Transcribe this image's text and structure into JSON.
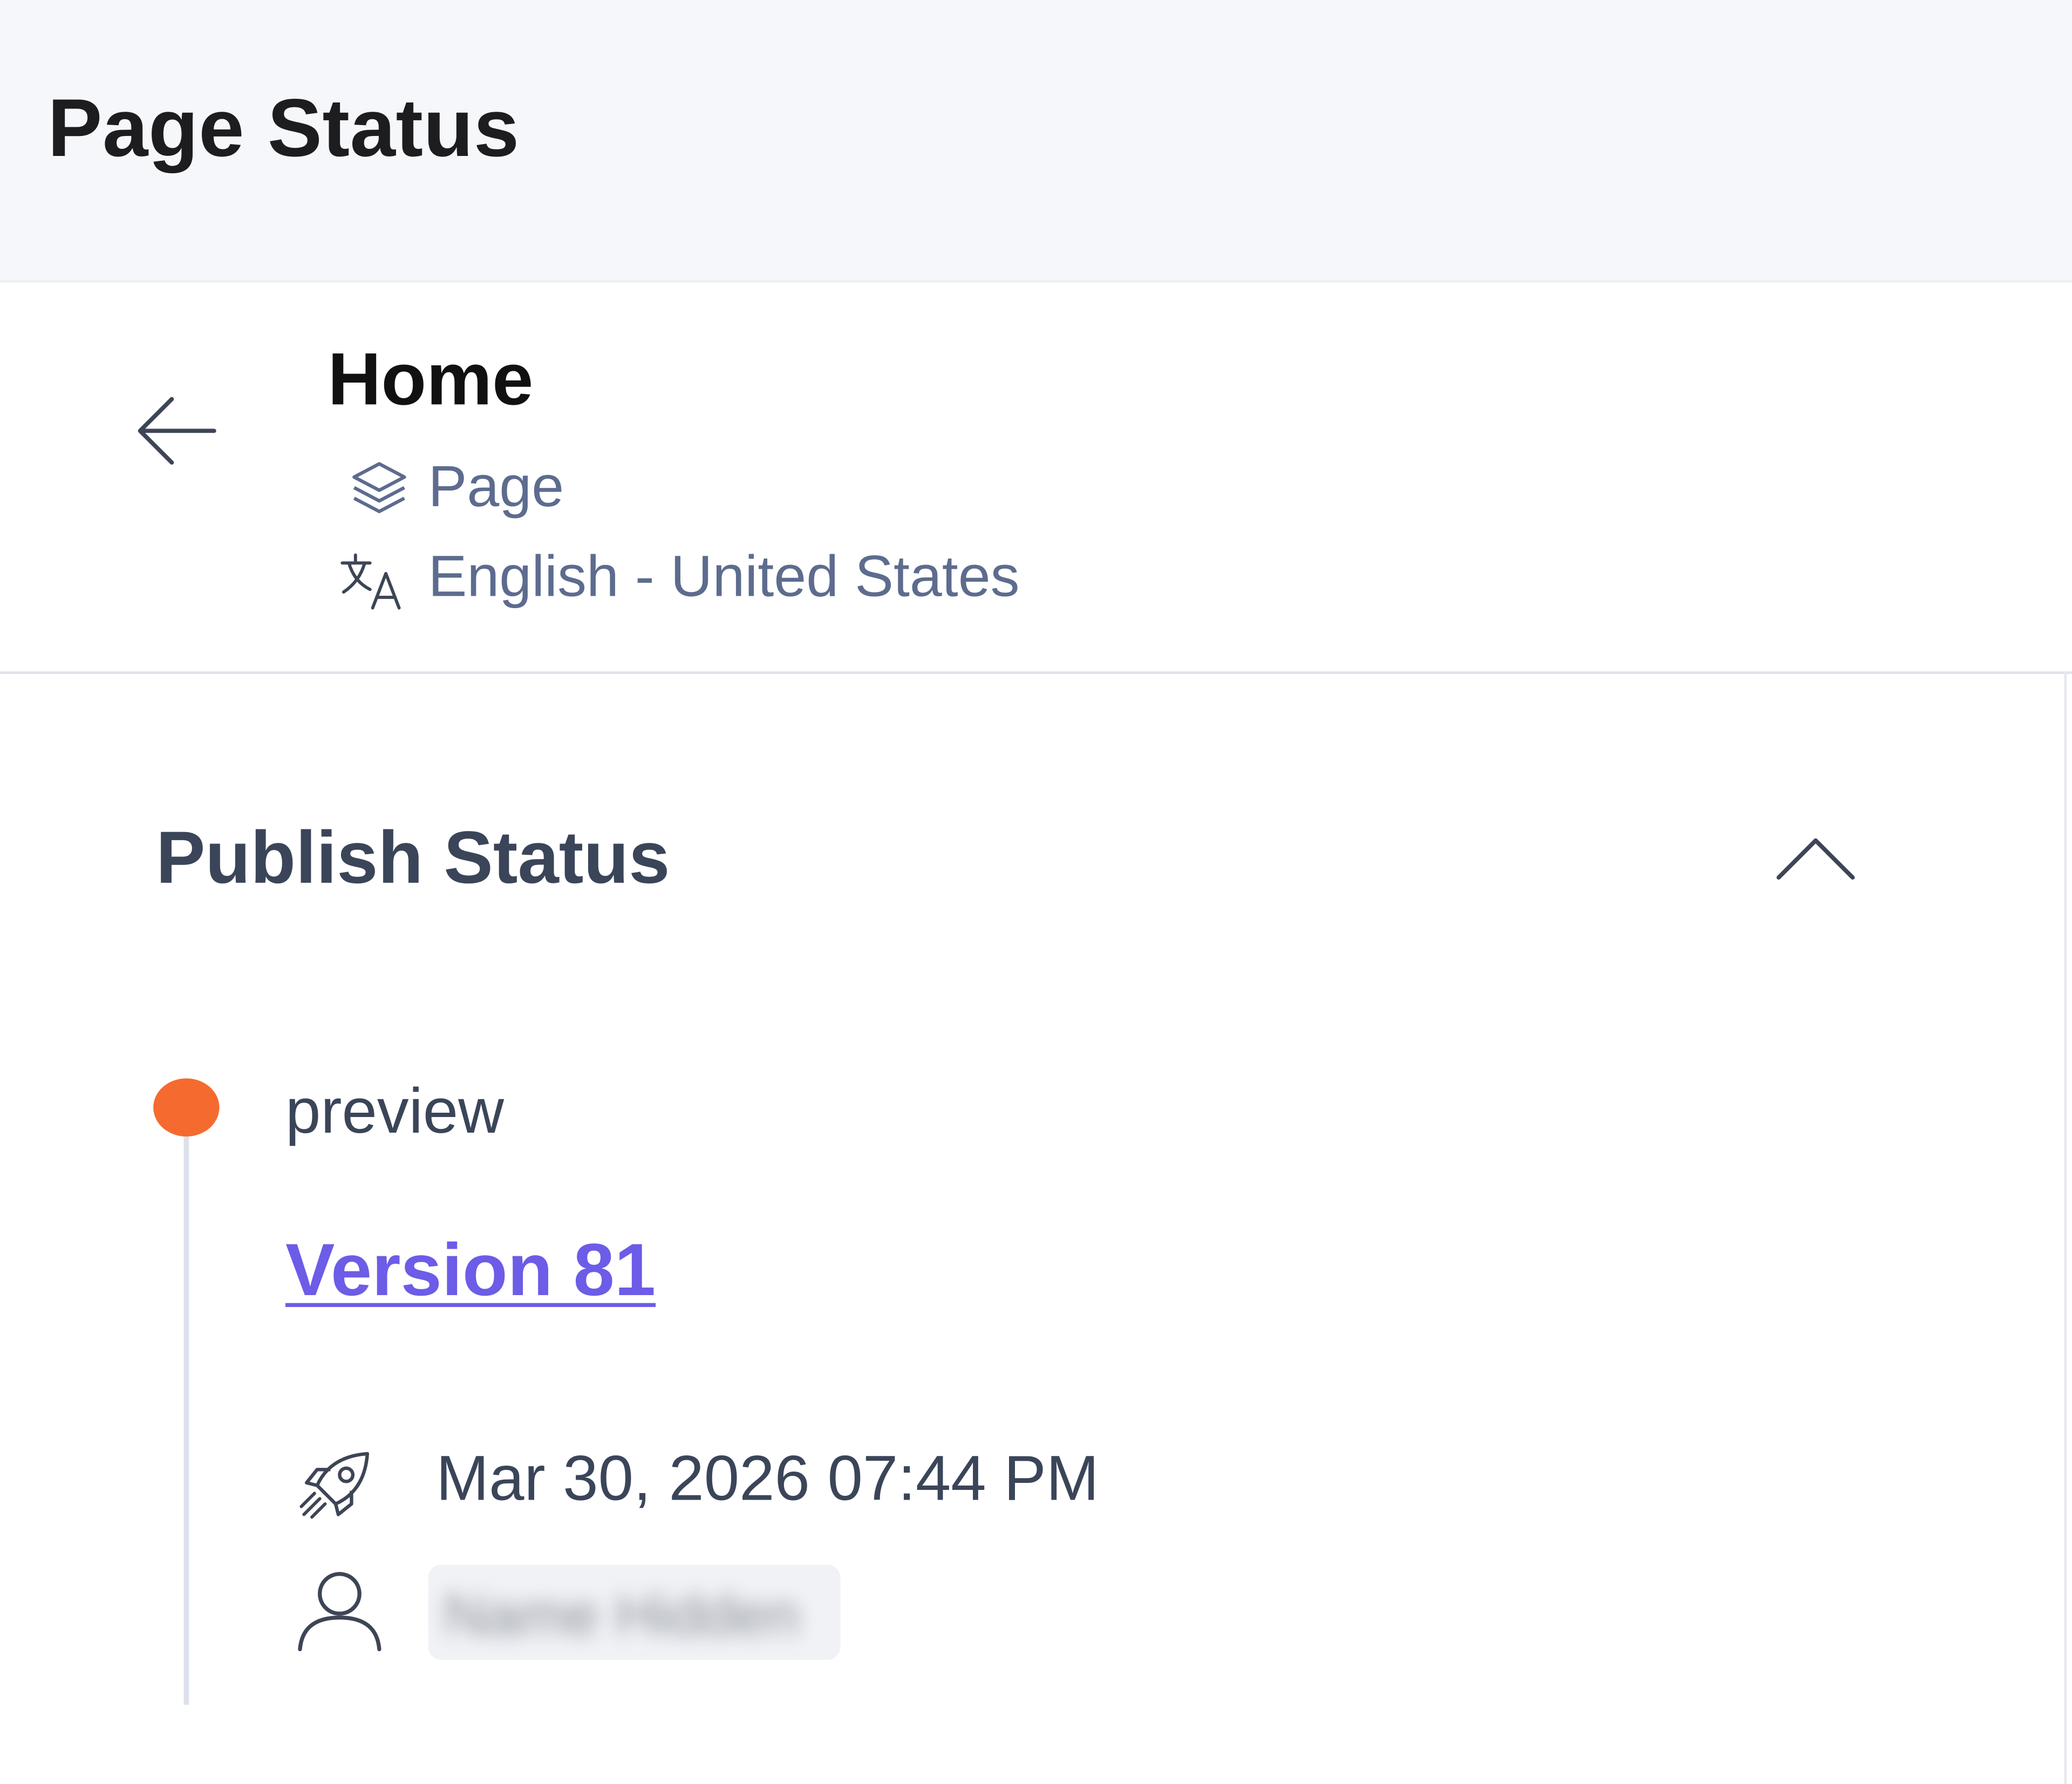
{
  "panel": {
    "title": "Page Status"
  },
  "entry": {
    "title": "Home",
    "type_label": "Page",
    "locale_label": "English - United States",
    "icons": {
      "back": "arrow-left-icon",
      "type": "layers-icon",
      "locale": "translate-icon"
    }
  },
  "publish_status": {
    "title": "Publish Status",
    "collapse_icon": "chevron-up-icon",
    "environment": "preview",
    "environment_color": "#f56b2f",
    "version_label": "Version 81",
    "published_at": "Mar 30, 2026 07:44 PM",
    "published_icon": "rocket-icon",
    "user_icon": "user-icon",
    "user_name_redacted": "Name Hidden"
  },
  "colors": {
    "header_bg": "#f6f7fb",
    "link": "#6c5ce7",
    "muted_text": "#5d6c8e",
    "body_text": "#3b4559"
  }
}
